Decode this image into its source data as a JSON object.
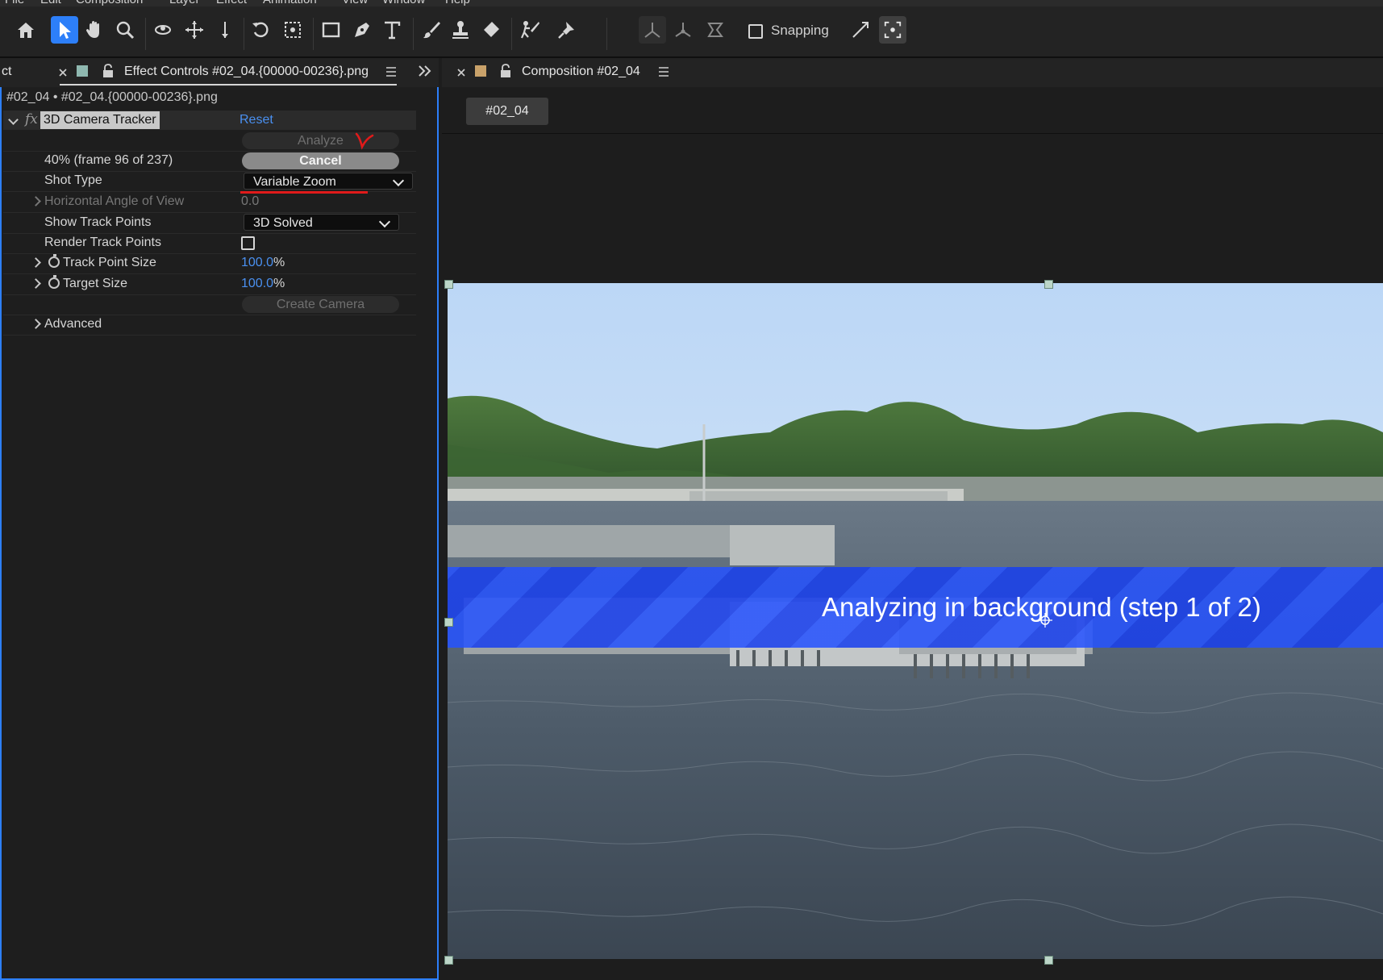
{
  "menu": {
    "items": [
      "File",
      "Edit",
      "Composition",
      "Layer",
      "Effect",
      "Animation",
      "View",
      "Window",
      "Help"
    ]
  },
  "toolbar": {
    "tools": [
      "home-icon",
      "selection-tool-icon",
      "hand-tool-icon",
      "zoom-tool-icon",
      "orbit-camera-icon",
      "pan-camera-icon",
      "dolly-camera-icon",
      "rotation-tool-icon",
      "pan-behind-icon",
      "rectangle-tool-icon",
      "pen-tool-icon",
      "type-tool-icon",
      "brush-tool-icon",
      "clone-stamp-icon",
      "eraser-icon",
      "roto-brush-icon",
      "puppet-pin-icon"
    ],
    "axis_tools": [
      "local-axis-icon",
      "world-axis-icon",
      "view-axis-icon"
    ],
    "snapping_label": "Snapping",
    "snapping_checked": false,
    "accent_color": "#2d7ff9"
  },
  "left_panel": {
    "cut_tab_label": "ct",
    "tab_title": "Effect Controls #02_04.{00000-00236}.png",
    "swatch_color": "#8fb8b0",
    "breadcrumb": "#02_04 • #02_04.{00000-00236}.png",
    "effect": {
      "fx_label": "fx",
      "name": "3D Camera Tracker",
      "reset_label": "Reset",
      "analyze_label": "Analyze",
      "progress_label": "40% (frame 96 of 237)",
      "progress_fraction": 0.4,
      "cancel_label": "Cancel",
      "shot_type": {
        "label": "Shot Type",
        "value": "Variable Zoom"
      },
      "horizontal_angle": {
        "label": "Horizontal Angle of View",
        "value": "0.0"
      },
      "show_track_points": {
        "label": "Show Track Points",
        "value": "3D Solved"
      },
      "render_track_points": {
        "label": "Render Track Points",
        "checked": false
      },
      "track_point_size": {
        "label": "Track Point Size",
        "value": "100.0",
        "unit": "%"
      },
      "target_size": {
        "label": "Target Size",
        "value": "100.0",
        "unit": "%"
      },
      "create_camera_label": "Create Camera",
      "advanced_label": "Advanced"
    }
  },
  "right_panel": {
    "tab_title": "Composition #02_04",
    "swatch_color": "#c9a26a",
    "comp_chip": "#02_04",
    "overlay_text": "Analyzing in background (step 1 of 2)",
    "overlay_color": "#2050f5"
  }
}
